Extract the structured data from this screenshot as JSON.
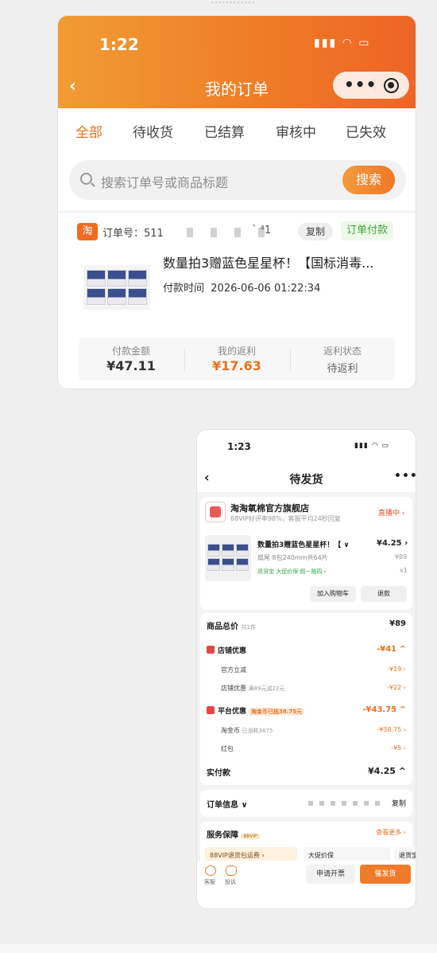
{
  "top_cut_text": "…………",
  "shot1": {
    "status_time": "1:22",
    "status_icons": "▮▮▮ ◠ ▭",
    "back": "‹",
    "title": "我的订单",
    "capsule_dots": "•••",
    "tabs": [
      {
        "label": "全部",
        "active": true
      },
      {
        "label": "待收货"
      },
      {
        "label": "已结算"
      },
      {
        "label": "审核中"
      },
      {
        "label": "已失效"
      }
    ],
    "search": {
      "placeholder": "搜索订单号或商品标题",
      "button": "搜索"
    },
    "order": {
      "platform_badge": "淘",
      "order_no_label": "订单号：511",
      "order_no_tail": "` ⁴1",
      "copy": "复制",
      "status_tag": "订单付款",
      "product_title": "数量拍3赠蓝色星星杯！【国标消毒...",
      "pay_time_label": "付款时间",
      "pay_time": "2026-06-06 01:22:34",
      "summary": [
        {
          "label": "付款金额",
          "value": "¥47.11"
        },
        {
          "label": "我的返利",
          "value": "¥17.63"
        },
        {
          "label": "返利状态",
          "value": "待返利"
        }
      ]
    }
  },
  "shot2": {
    "status_time": "1:23",
    "status_icons": "▮▮▮ ◠ ▭",
    "back": "‹",
    "title": "待发货",
    "more": "•••",
    "shop": {
      "name": "淘淘氧棉官方旗舰店",
      "sub": "88VIP好评率98%，客服平均24秒回复",
      "live": "直播中 ›"
    },
    "item": {
      "title": "数量拍3赠蓝色星星杯！【 ∨",
      "price": "¥4.25 ›",
      "orig_price": "¥89",
      "spec": "扇尾 8包240mm共64片",
      "qty": "x1",
      "tags": "退货宝  大促价保  假一赔四 ›",
      "btn_cart": "加入购物车",
      "btn_refund": "退款"
    },
    "price_detail": {
      "goods_total_label": "商品总价",
      "goods_total_count": "共1件",
      "goods_total": "¥89",
      "shop_discount_label": "店铺优惠",
      "shop_discount": "-¥41 ^",
      "official_label": "官方立减",
      "official": "-¥19 ›",
      "shop_coupon_label": "店铺优惠",
      "shop_coupon_note": "满89元减22元",
      "shop_coupon": "-¥22 ›",
      "platform_label": "平台优惠",
      "platform_pill": "淘金币已抵38.75元",
      "platform": "-¥43.75 ^",
      "coin_label": "淘金币",
      "coin_note": "已消耗3875",
      "coin": "-¥38.75 ›",
      "redpack_label": "红包",
      "redpack": "-¥5 ›",
      "paid_label": "实付款",
      "paid": "¥4.25 ^"
    },
    "order_info": {
      "label": "订单信息 ∨",
      "copy": "复制"
    },
    "service": {
      "label": "服务保障",
      "badge": "88VIP",
      "more": "查看更多 ›",
      "chips": [
        "88VIP退货包运费 ›",
        "大促价保",
        "退货宝"
      ]
    },
    "bottom": {
      "cs": "客服",
      "complain": "投诉",
      "invoice": "申请开票",
      "urge": "催发货"
    }
  }
}
